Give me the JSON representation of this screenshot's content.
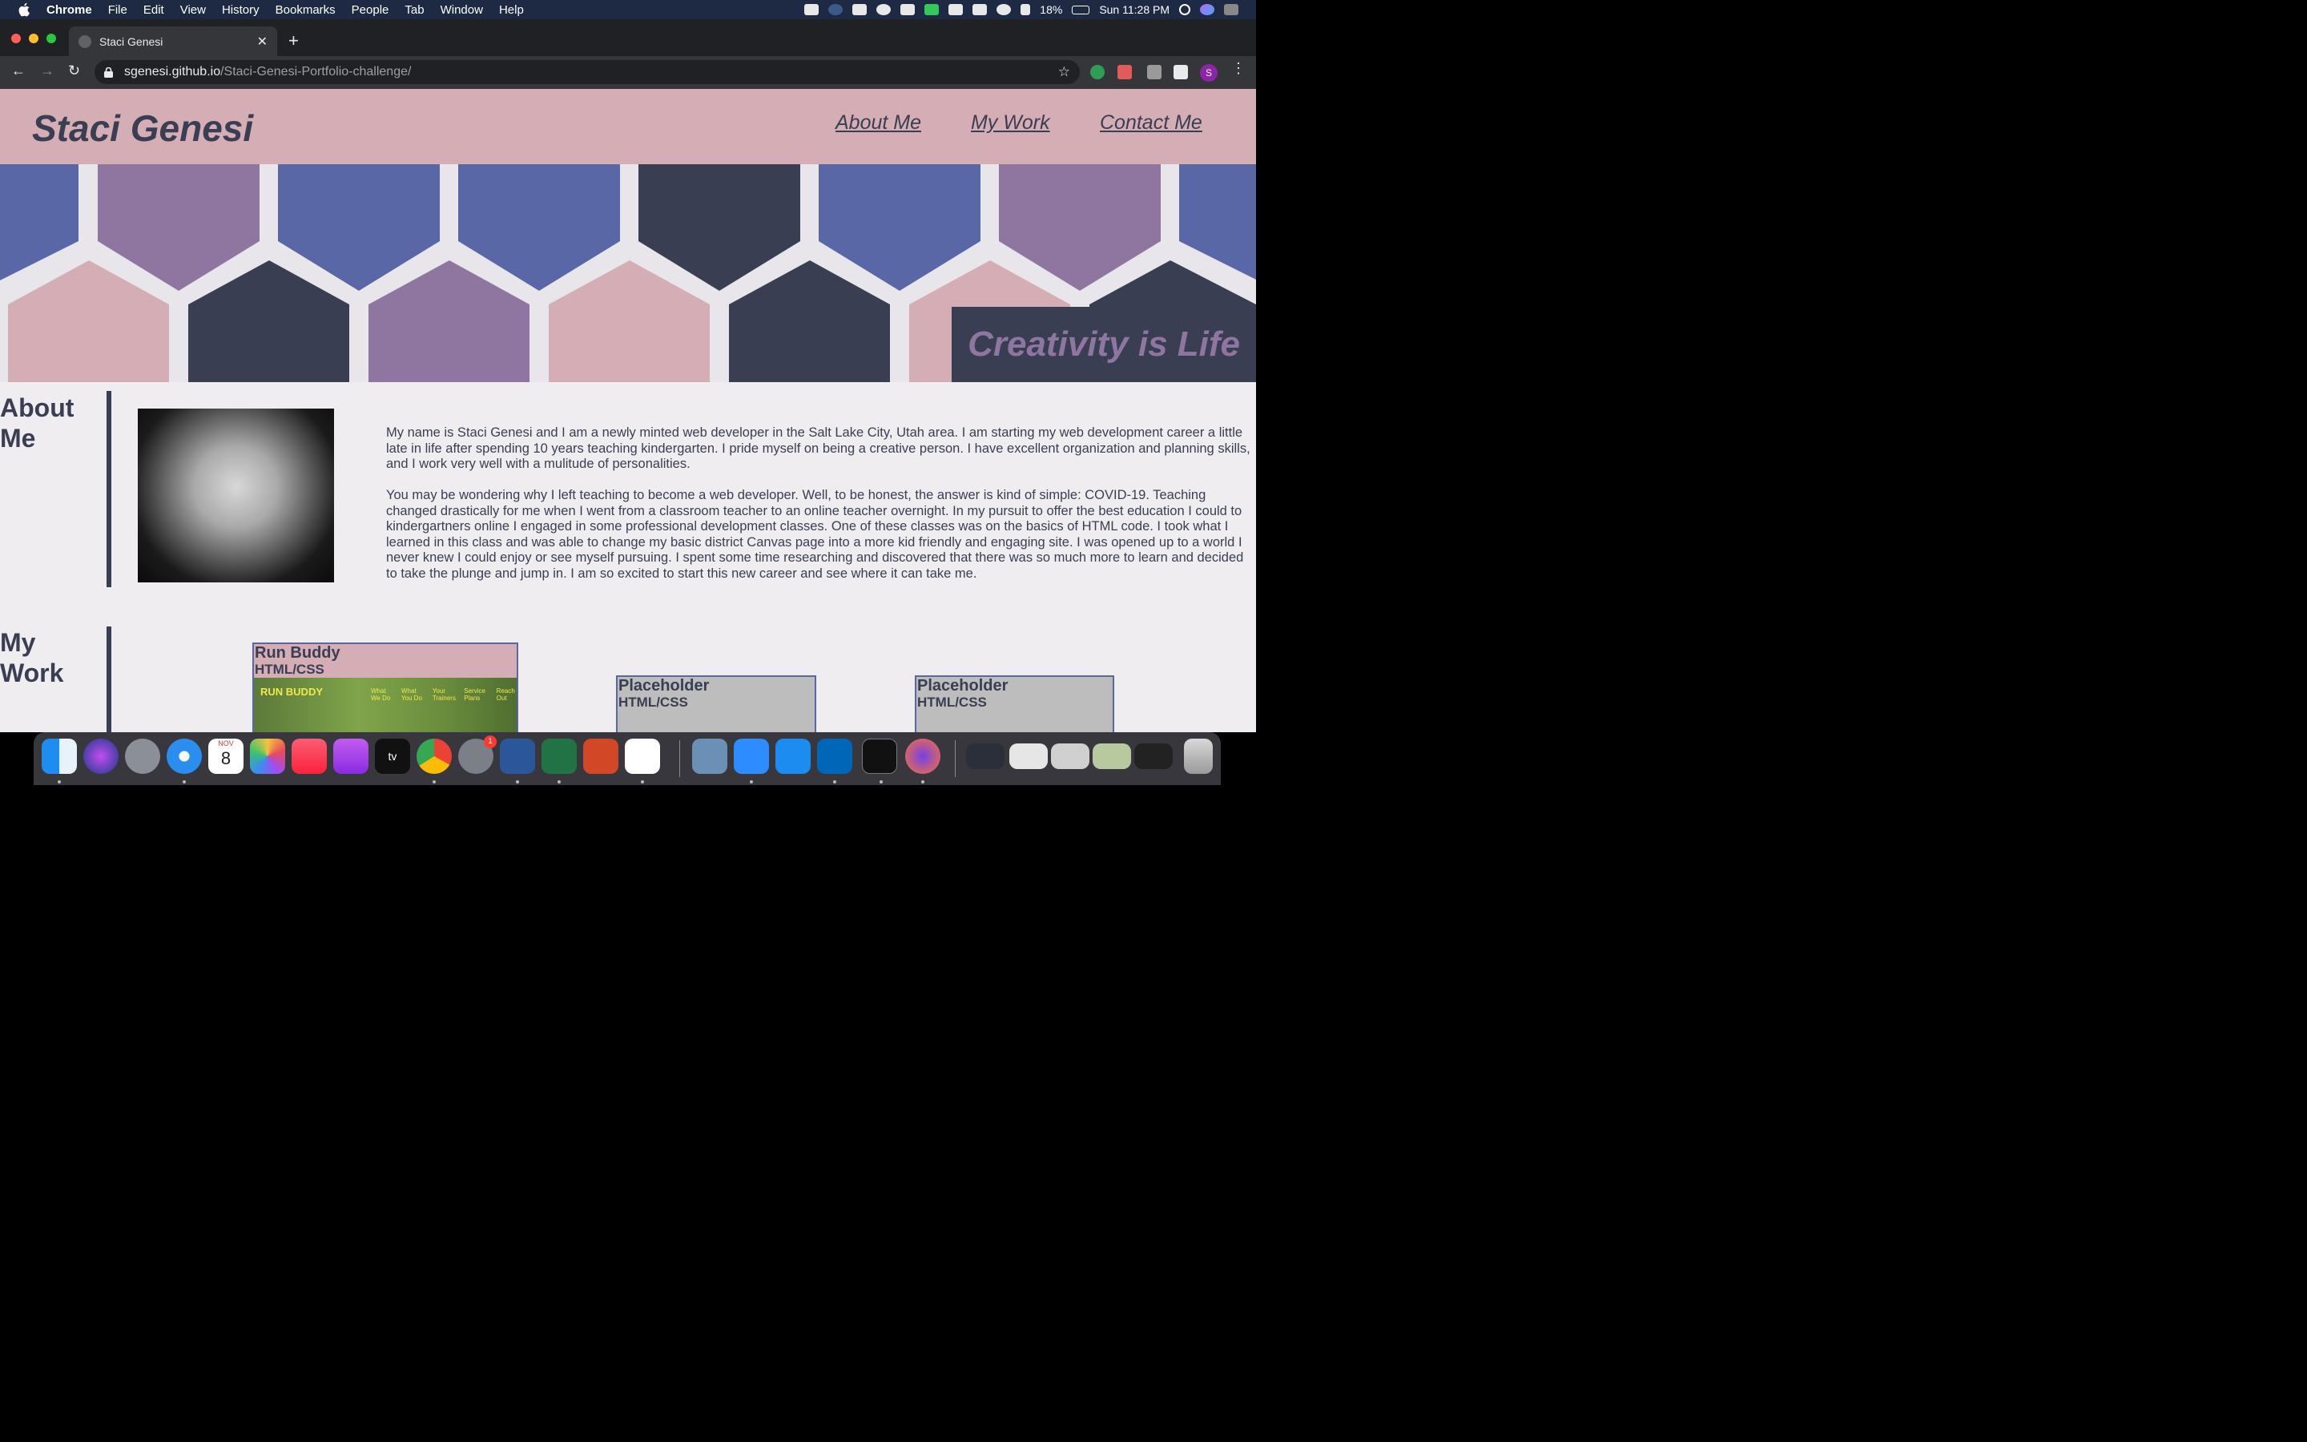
{
  "menubar": {
    "app_name": "Chrome",
    "items": [
      "File",
      "Edit",
      "View",
      "History",
      "Bookmarks",
      "People",
      "Tab",
      "Window",
      "Help"
    ],
    "battery": "18%",
    "clock": "Sun 11:28 PM"
  },
  "browser": {
    "tab_title": "Staci Genesi",
    "url_host": "sgenesi.github.io",
    "url_path": "/Staci-Genesi-Portfolio-challenge/",
    "profile_initial": "S"
  },
  "site": {
    "title": "Staci Genesi",
    "nav": [
      "About Me",
      "My Work",
      "Contact Me"
    ],
    "tagline": "Creativity is Life",
    "about": {
      "heading": "About Me",
      "paragraph1": "My name is Staci Genesi and I am a newly minted web developer in the Salt Lake City, Utah area. I am starting my web development career a little late in life after spending 10 years teaching kindergarten. I pride myself on being a creative person. I have excellent organization and planning skills, and I work very well with a mulitude of personalities.",
      "paragraph2": "You may be wondering why I left teaching to become a web developer. Well, to be honest, the answer is kind of simple: COVID-19. Teaching changed drastically for me when I went from a classroom teacher to an online teacher overnight. In my pursuit to offer the best education I could to kindergartners online I engaged in some professional development classes. One of these classes was on the basics of HTML code. I took what I learned in this class and was able to change my basic district Canvas page into a more kid friendly and engaging site. I was opened up to a world I never knew I could enjoy or see myself pursuing. I spent some time researching and discovered that there was so much more to learn and decided to take the plunge and jump in. I am so excited to start this new career and see where it can take me."
    },
    "work": {
      "heading": "My Work",
      "projects": [
        {
          "name": "Run Buddy",
          "tech": "HTML/CSS",
          "shot_logo": "RUN BUDDY",
          "shot_nav": [
            "What We Do",
            "What You Do",
            "Your Trainers",
            "Service Plans",
            "Reach Out"
          ]
        },
        {
          "name": "Placeholder",
          "tech": "HTML/CSS"
        },
        {
          "name": "Placeholder",
          "tech": "HTML/CSS"
        }
      ]
    }
  },
  "colors": {
    "header_pink": "#d4adb5",
    "navy": "#393e53",
    "blue_hex": "#5a67a6",
    "purple_hex": "#8e76a0",
    "page_bg": "#f0edf1"
  },
  "dock": {
    "apps": [
      "finder-icon",
      "siri-icon",
      "launchpad-icon",
      "safari-icon",
      "calendar-icon",
      "photos-icon",
      "music-icon",
      "podcasts-icon",
      "apple-tv-icon",
      "chrome-icon",
      "system-preferences-icon",
      "word-icon",
      "excel-icon",
      "powerpoint-icon",
      "slack-icon",
      "preview-icon",
      "zoom-icon",
      "xcode-icon",
      "vscode-icon",
      "terminal-icon",
      "firefox-icon"
    ],
    "calendar_month": "NOV",
    "calendar_day": "8",
    "badge_system_preferences": "1"
  }
}
